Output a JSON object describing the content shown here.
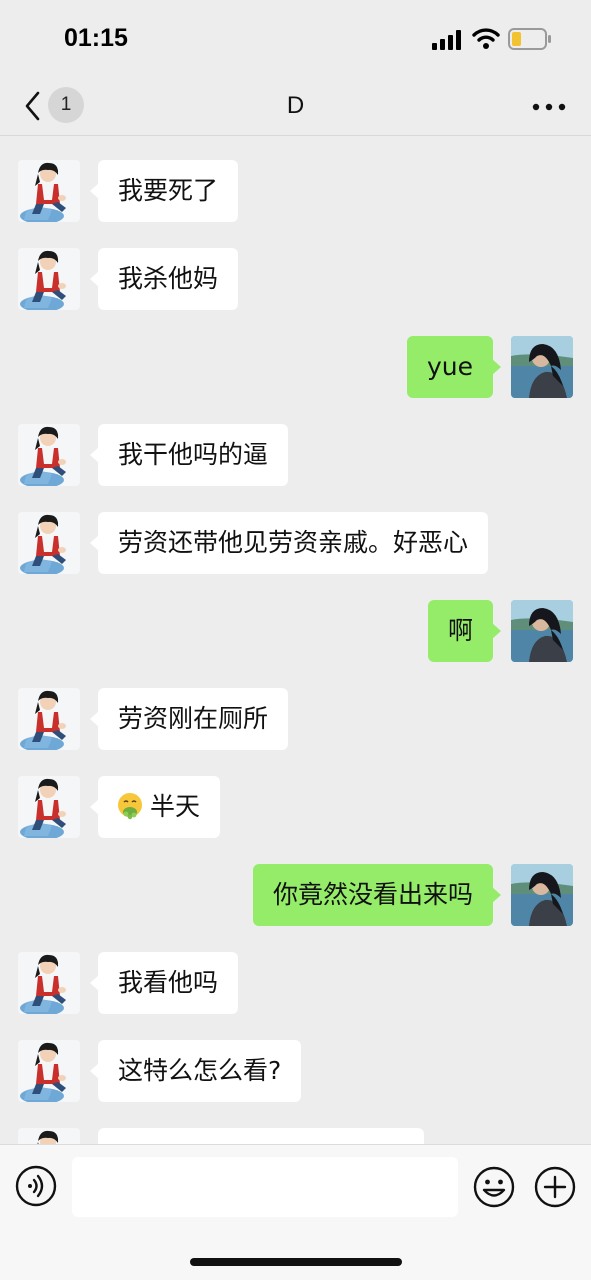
{
  "status_bar": {
    "time": "01:15",
    "icons": [
      "cellular-signal-icon",
      "wifi-icon",
      "battery-low-icon"
    ],
    "battery_color": "#f2c230"
  },
  "nav": {
    "back_icon": "chevron-left-icon",
    "unread_count": "1",
    "title": "D",
    "more_icon": "more-dots-icon"
  },
  "colors": {
    "background": "#ededed",
    "incoming_bubble": "#ffffff",
    "outgoing_bubble": "#95ec69"
  },
  "messages": [
    {
      "sender": "contact",
      "text": "我要死了"
    },
    {
      "sender": "contact",
      "text": "我杀他妈"
    },
    {
      "sender": "me",
      "text": "yue"
    },
    {
      "sender": "contact",
      "text": "我干他吗的逼"
    },
    {
      "sender": "contact",
      "text": "劳资还带他见劳资亲戚。好恶心"
    },
    {
      "sender": "me",
      "text": "啊"
    },
    {
      "sender": "contact",
      "text": "劳资刚在厕所"
    },
    {
      "sender": "contact",
      "emoji": "nauseated-face-emoji",
      "text": "半天"
    },
    {
      "sender": "me",
      "text": "你竟然没看出来吗"
    },
    {
      "sender": "contact",
      "text": "我看他吗"
    },
    {
      "sender": "contact",
      "text": "这特么怎么看?"
    },
    {
      "sender": "contact",
      "text": ""
    }
  ],
  "input_bar": {
    "voice_icon": "voice-input-icon",
    "text_value": "",
    "emoji_icon": "emoji-smile-icon",
    "plus_icon": "plus-circle-icon"
  }
}
